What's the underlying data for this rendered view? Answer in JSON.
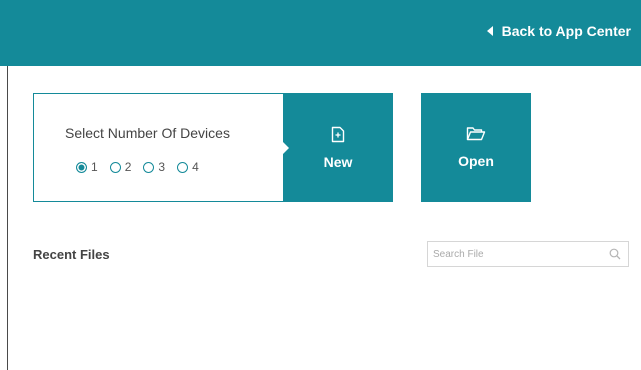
{
  "header": {
    "back_label": "Back to App Center",
    "color": "#148a99"
  },
  "devices": {
    "title": "Select Number Of Devices",
    "options": [
      "1",
      "2",
      "3",
      "4"
    ],
    "selected": "1"
  },
  "actions": {
    "new_label": "New",
    "open_label": "Open"
  },
  "recent": {
    "title": "Recent Files",
    "search_placeholder": "Search File",
    "search_value": ""
  },
  "icons": {
    "back": "caret-left-icon",
    "new": "new-file-icon",
    "open": "folder-open-icon",
    "search": "search-icon"
  }
}
